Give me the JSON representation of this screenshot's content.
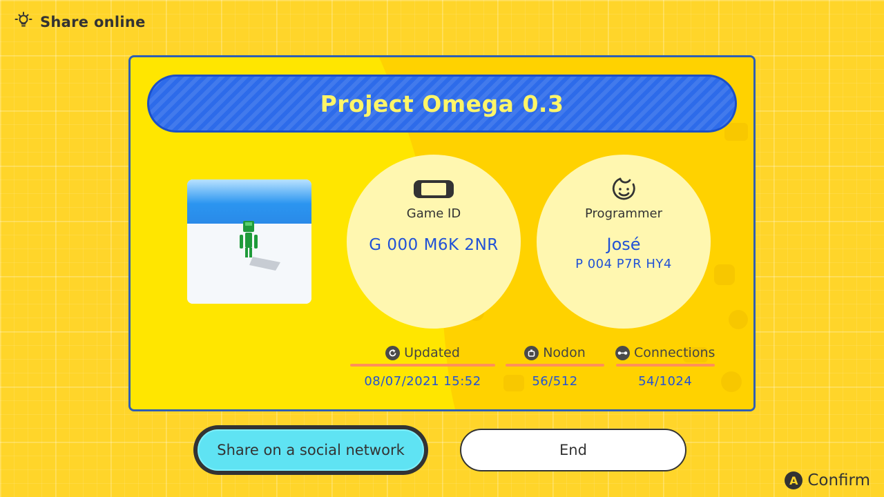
{
  "header": {
    "title": "Share online",
    "icon": "lightbulb-icon"
  },
  "card": {
    "title": "Project Omega 0.3",
    "game_id": {
      "label": "Game ID",
      "value": "G 000 M6K 2NR",
      "icon": "switch-console-icon"
    },
    "programmer": {
      "label": "Programmer",
      "name": "José",
      "code": "P 004 P7R HY4",
      "icon": "face-icon"
    },
    "stats": {
      "updated": {
        "label": "Updated",
        "value": "08/07/2021 15:52",
        "icon": "refresh-icon"
      },
      "nodon": {
        "label": "Nodon",
        "value": "56/512",
        "icon": "nodon-icon"
      },
      "connections": {
        "label": "Connections",
        "value": "54/1024",
        "icon": "connection-icon"
      }
    }
  },
  "buttons": {
    "share": "Share on a social network",
    "end": "End"
  },
  "footer": {
    "button_glyph": "A",
    "confirm": "Confirm"
  },
  "colors": {
    "background": "#ffd52a",
    "accent_blue": "#2d6bea",
    "value_text": "#2152d6",
    "selected_button": "#5fe3f3",
    "stat_underline": "#ff8f5a"
  }
}
